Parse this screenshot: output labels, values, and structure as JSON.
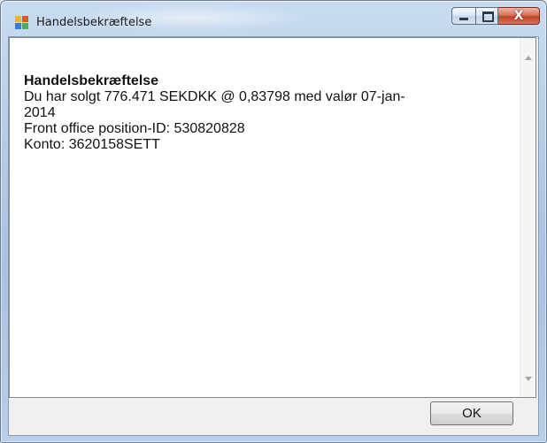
{
  "window": {
    "title": "Handelsbekræftelse",
    "icon": "app-window-icon"
  },
  "caption_buttons": {
    "minimize": "minimize-icon",
    "maximize": "maximize-icon",
    "close": "close-icon",
    "close_glyph": "X"
  },
  "message": {
    "heading": "Handelsbekræftelse",
    "line1": "Du har solgt 776.471 SEKDKK @ 0,83798 med valør 07-jan-",
    "line2": "2014",
    "line3": "Front office position-ID: 530820828",
    "line4": "Konto: 3620158SETT"
  },
  "buttons": {
    "ok_label": "OK"
  },
  "colors": {
    "title_bar": "#b6cde8",
    "close_button": "#c2412a",
    "text": "#111111"
  }
}
